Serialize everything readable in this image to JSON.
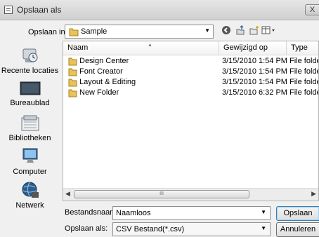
{
  "window": {
    "title": "Opslaan als",
    "close_label": "X"
  },
  "toolbar": {
    "lookin_label": "Opslaan in:",
    "lookin_value": "Sample",
    "icons": [
      "back-icon",
      "up-folder-icon",
      "new-folder-icon",
      "views-menu-icon"
    ]
  },
  "places": [
    {
      "label": "Recente locaties",
      "icon": "recent-places-icon"
    },
    {
      "label": "Bureaublad",
      "icon": "desktop-icon"
    },
    {
      "label": "Bibliotheken",
      "icon": "libraries-icon"
    },
    {
      "label": "Computer",
      "icon": "computer-icon"
    },
    {
      "label": "Netwerk",
      "icon": "network-icon"
    }
  ],
  "files": {
    "columns": [
      "Naam",
      "Gewijzigd op",
      "Type"
    ],
    "rows": [
      {
        "name": "Design Center",
        "modified": "3/15/2010 1:54 PM",
        "type": "File folder"
      },
      {
        "name": "Font Creator",
        "modified": "3/15/2010 1:54 PM",
        "type": "File folder"
      },
      {
        "name": "Layout & Editing",
        "modified": "3/15/2010 1:54 PM",
        "type": "File folder"
      },
      {
        "name": "New Folder",
        "modified": "3/15/2010 6:32 PM",
        "type": "File folder"
      }
    ],
    "scroll_grip": "III"
  },
  "filename": {
    "label": "Bestandsnaam:",
    "value": "Naamloos"
  },
  "filetype": {
    "label": "Opslaan als:",
    "value": "CSV Bestand(*.csv)"
  },
  "buttons": {
    "save": "Opslaan",
    "cancel": "Annuleren"
  },
  "colors": {
    "folder": "#e8c25a",
    "selection_border": "#3c7fb1"
  }
}
